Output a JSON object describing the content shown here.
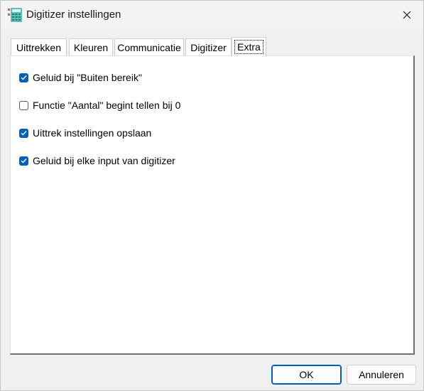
{
  "window": {
    "title": "Digitizer instellingen",
    "icon": "calculator-app-icon",
    "close_icon": "close-icon"
  },
  "tabs": [
    {
      "label": "Uittrekken",
      "active": false
    },
    {
      "label": "Kleuren",
      "active": false
    },
    {
      "label": "Communicatie",
      "active": false
    },
    {
      "label": "Digitizer",
      "active": false
    },
    {
      "label": "Extra",
      "active": true
    }
  ],
  "options": [
    {
      "label": "Geluid bij \"Buiten bereik\"",
      "checked": true
    },
    {
      "label": "Functie \"Aantal\" begint tellen bij 0",
      "checked": false
    },
    {
      "label": "Uittrek instellingen opslaan",
      "checked": true
    },
    {
      "label": "Geluid bij elke input van digitizer",
      "checked": true
    }
  ],
  "buttons": {
    "ok": "OK",
    "cancel": "Annuleren"
  },
  "colors": {
    "accent": "#005fb8",
    "panel": "#ffffff",
    "window": "#f0f0f0"
  }
}
